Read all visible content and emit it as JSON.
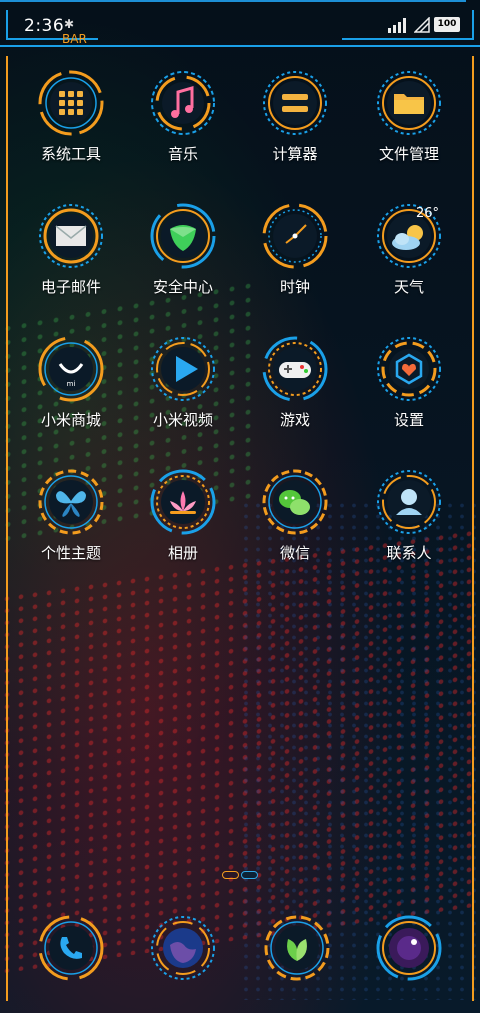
{
  "status": {
    "time": "2:36",
    "bar_label": "BAR",
    "battery": "100"
  },
  "colors": {
    "accent_orange": "#f39c1e",
    "accent_cyan": "#1aa0e8",
    "background": "#05101a"
  },
  "apps": [
    {
      "label": "系统工具",
      "icon": "tools-icon"
    },
    {
      "label": "音乐",
      "icon": "music-icon"
    },
    {
      "label": "计算器",
      "icon": "calculator-icon"
    },
    {
      "label": "文件管理",
      "icon": "folder-icon"
    },
    {
      "label": "电子邮件",
      "icon": "mail-icon"
    },
    {
      "label": "安全中心",
      "icon": "shield-icon"
    },
    {
      "label": "时钟",
      "icon": "clock-icon"
    },
    {
      "label": "天气",
      "icon": "weather-icon",
      "temp": "26°"
    },
    {
      "label": "小米商城",
      "icon": "mi-store-icon"
    },
    {
      "label": "小米视频",
      "icon": "video-icon"
    },
    {
      "label": "游戏",
      "icon": "gamepad-icon"
    },
    {
      "label": "设置",
      "icon": "settings-icon"
    },
    {
      "label": "个性主题",
      "icon": "butterfly-icon"
    },
    {
      "label": "相册",
      "icon": "lotus-icon"
    },
    {
      "label": "微信",
      "icon": "wechat-icon"
    },
    {
      "label": "联系人",
      "icon": "contacts-icon"
    }
  ],
  "dock": [
    {
      "icon": "phone-icon"
    },
    {
      "icon": "browser-globe-icon"
    },
    {
      "icon": "leaf-icon"
    },
    {
      "icon": "camera-icon"
    }
  ]
}
